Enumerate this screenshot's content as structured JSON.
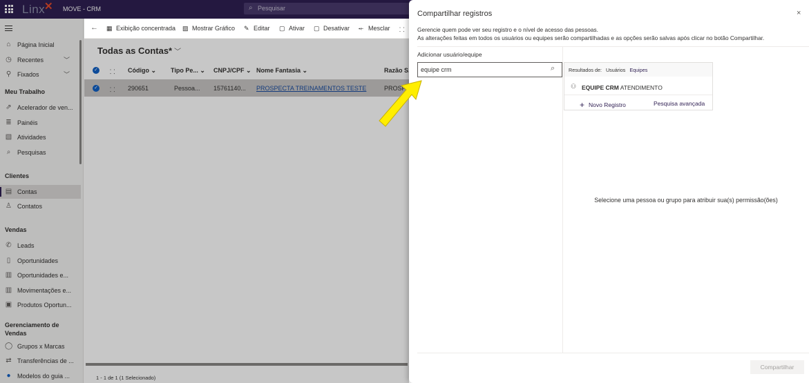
{
  "app": {
    "logo_text": "Linx",
    "name": "MOVE - CRM",
    "search_placeholder": "Pesquisar"
  },
  "sidebar": {
    "items": [
      {
        "label": "Página Inicial",
        "icon": "home-icon"
      },
      {
        "label": "Recentes",
        "icon": "clock-icon"
      },
      {
        "label": "Fixados",
        "icon": "pin-icon"
      }
    ],
    "sections": [
      {
        "title": "Meu Trabalho",
        "items": [
          {
            "label": "Acelerador de ven...",
            "icon": "rocket-icon"
          },
          {
            "label": "Painéis",
            "icon": "dashboard-icon"
          },
          {
            "label": "Atividades",
            "icon": "clipboard-icon"
          },
          {
            "label": "Pesquisas",
            "icon": "search-icon"
          }
        ]
      },
      {
        "title": "Clientes",
        "items": [
          {
            "label": "Contas",
            "icon": "building-icon"
          },
          {
            "label": "Contatos",
            "icon": "person-icon"
          }
        ]
      },
      {
        "title": "Vendas",
        "items": [
          {
            "label": "Leads",
            "icon": "phone-icon"
          },
          {
            "label": "Oportunidades",
            "icon": "document-icon"
          },
          {
            "label": "Oportunidades e...",
            "icon": "documents-icon"
          },
          {
            "label": "Movimentações e...",
            "icon": "documents-icon"
          },
          {
            "label": "Produtos Oportun...",
            "icon": "box-icon"
          }
        ]
      },
      {
        "title": "Gerenciamento de Vendas",
        "items": [
          {
            "label": "Grupos x Marcas",
            "icon": "circle-icon"
          },
          {
            "label": "Transferências de ...",
            "icon": "transfer-icon"
          },
          {
            "label": "Modelos do guia ...",
            "icon": "dot-icon"
          }
        ]
      }
    ]
  },
  "commandbar": {
    "items": [
      "Exibição concentrada",
      "Mostrar Gráfico",
      "Editar",
      "Ativar",
      "Desativar",
      "Mesclar"
    ]
  },
  "view": {
    "title": "Todas as Contas*",
    "columns": [
      "Código",
      "Tipo Pe...",
      "CNPJ/CPF",
      "Nome Fantasia",
      "Razão S..."
    ],
    "rows": [
      {
        "codigo": "290651",
        "tipo": "Pessoa...",
        "cnpj": "15761140...",
        "nome": "PROSPECTA TREINAMENTOS TESTE",
        "razao": "PROSP..."
      }
    ],
    "footer": "1 - 1 de 1 (1 Selecionado)"
  },
  "share_panel": {
    "title": "Compartilhar registros",
    "close_glyph": "×",
    "description_line1": "Gerencie quem pode ver seu registro e o nível de acesso das pessoas.",
    "description_line2": "As alterações feitas em todos os usuários ou equipes serão compartilhadas e as opções serão salvas após clicar no botão Compartilhar.",
    "add_label": "Adicionar usuário/equipe",
    "search_value": "equipe crm",
    "results_label": "Resultados de:",
    "tab_users": "Usuários",
    "tab_teams": "Equipes",
    "result_bold": "EQUIPE CRM",
    "result_rest": " ATENDIMENTO",
    "new_record": "Novo Registro",
    "advanced_search": "Pesquisa avançada",
    "empty_message": "Selecione uma pessoa ou grupo para atribuir sua(s) permissão(ões)",
    "share_button": "Compartilhar"
  },
  "colors": {
    "topbar": "#2f1f52",
    "accent": "#0f5fc4",
    "arrow": "#ffee00"
  }
}
